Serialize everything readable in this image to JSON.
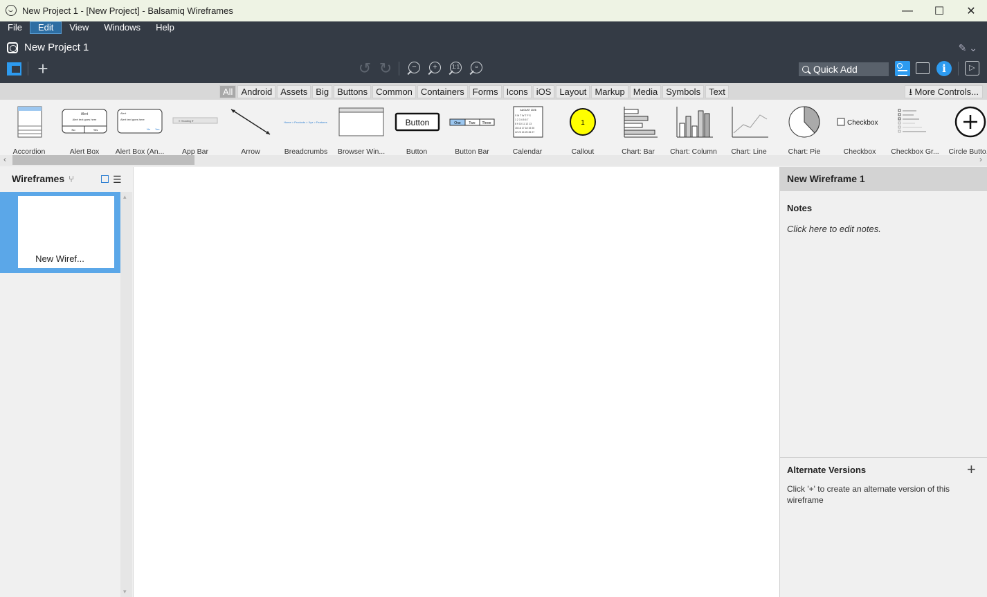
{
  "window": {
    "title": "New Project 1 - [New Project] - Balsamiq Wireframes",
    "controls": {
      "minimize": "—",
      "maximize": "☐",
      "close": "✕"
    }
  },
  "menu": [
    "File",
    "Edit",
    "View",
    "Windows",
    "Help"
  ],
  "menu_active": "Edit",
  "project": {
    "name": "New Project 1"
  },
  "toolbar": {
    "quick_add_placeholder": "Quick Add",
    "zoom_actual_label": "1:1"
  },
  "categories": [
    "All",
    "Android",
    "Assets",
    "Big",
    "Buttons",
    "Common",
    "Containers",
    "Forms",
    "Icons",
    "iOS",
    "Layout",
    "Markup",
    "Media",
    "Symbols",
    "Text"
  ],
  "category_active": "All",
  "more_controls": "More Controls...",
  "components": [
    {
      "label": "Accordion"
    },
    {
      "label": "Alert Box"
    },
    {
      "label": "Alert Box (An..."
    },
    {
      "label": "App Bar"
    },
    {
      "label": "Arrow"
    },
    {
      "label": "Breadcrumbs"
    },
    {
      "label": "Browser Win..."
    },
    {
      "label": "Button"
    },
    {
      "label": "Button Bar"
    },
    {
      "label": "Calendar"
    },
    {
      "label": "Callout"
    },
    {
      "label": "Chart: Bar"
    },
    {
      "label": "Chart: Column"
    },
    {
      "label": "Chart: Line"
    },
    {
      "label": "Chart: Pie"
    },
    {
      "label": "Checkbox"
    },
    {
      "label": "Checkbox Gr..."
    },
    {
      "label": "Circle Butto..."
    }
  ],
  "component_thumb_text": {
    "button": "Button",
    "checkbox": "Checkbox",
    "callout": "1",
    "alert_title": "Alert",
    "alert_text": "Alert text goes here",
    "alert_no": "No",
    "alert_yes": "Yes",
    "button_bar": [
      "One",
      "Two",
      "Three"
    ],
    "breadcrumbs": "Home > Products > Xyz > Features",
    "calendar_month": "AUGUST 2026"
  },
  "left_panel": {
    "title": "Wireframes",
    "items": [
      {
        "name": "New Wiref..."
      }
    ]
  },
  "right_panel": {
    "wireframe_title": "New Wireframe 1",
    "notes_heading": "Notes",
    "notes_placeholder": "Click here to edit notes.",
    "alternate_heading": "Alternate Versions",
    "alternate_add": "+",
    "alternate_text": "Click '+' to create an alternate version of this wireframe"
  },
  "colors": {
    "accent": "#2d9bf0",
    "header_bg": "#343b45",
    "selected_item": "#5ba7e8"
  }
}
